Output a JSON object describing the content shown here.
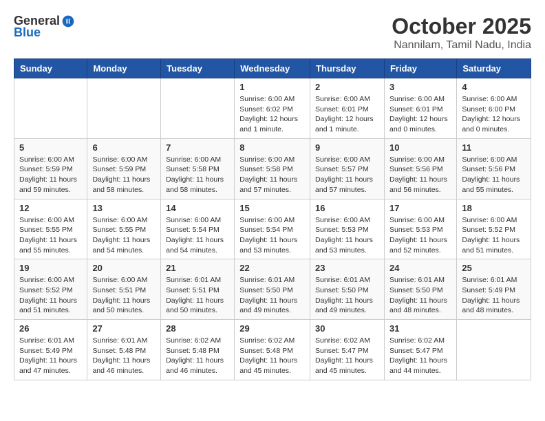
{
  "header": {
    "logo_general": "General",
    "logo_blue": "Blue",
    "month": "October 2025",
    "location": "Nannilam, Tamil Nadu, India"
  },
  "weekdays": [
    "Sunday",
    "Monday",
    "Tuesday",
    "Wednesday",
    "Thursday",
    "Friday",
    "Saturday"
  ],
  "weeks": [
    [
      {
        "day": "",
        "sunrise": "",
        "sunset": "",
        "daylight": ""
      },
      {
        "day": "",
        "sunrise": "",
        "sunset": "",
        "daylight": ""
      },
      {
        "day": "",
        "sunrise": "",
        "sunset": "",
        "daylight": ""
      },
      {
        "day": "1",
        "sunrise": "Sunrise: 6:00 AM",
        "sunset": "Sunset: 6:02 PM",
        "daylight": "Daylight: 12 hours and 1 minute."
      },
      {
        "day": "2",
        "sunrise": "Sunrise: 6:00 AM",
        "sunset": "Sunset: 6:01 PM",
        "daylight": "Daylight: 12 hours and 1 minute."
      },
      {
        "day": "3",
        "sunrise": "Sunrise: 6:00 AM",
        "sunset": "Sunset: 6:01 PM",
        "daylight": "Daylight: 12 hours and 0 minutes."
      },
      {
        "day": "4",
        "sunrise": "Sunrise: 6:00 AM",
        "sunset": "Sunset: 6:00 PM",
        "daylight": "Daylight: 12 hours and 0 minutes."
      }
    ],
    [
      {
        "day": "5",
        "sunrise": "Sunrise: 6:00 AM",
        "sunset": "Sunset: 5:59 PM",
        "daylight": "Daylight: 11 hours and 59 minutes."
      },
      {
        "day": "6",
        "sunrise": "Sunrise: 6:00 AM",
        "sunset": "Sunset: 5:59 PM",
        "daylight": "Daylight: 11 hours and 58 minutes."
      },
      {
        "day": "7",
        "sunrise": "Sunrise: 6:00 AM",
        "sunset": "Sunset: 5:58 PM",
        "daylight": "Daylight: 11 hours and 58 minutes."
      },
      {
        "day": "8",
        "sunrise": "Sunrise: 6:00 AM",
        "sunset": "Sunset: 5:58 PM",
        "daylight": "Daylight: 11 hours and 57 minutes."
      },
      {
        "day": "9",
        "sunrise": "Sunrise: 6:00 AM",
        "sunset": "Sunset: 5:57 PM",
        "daylight": "Daylight: 11 hours and 57 minutes."
      },
      {
        "day": "10",
        "sunrise": "Sunrise: 6:00 AM",
        "sunset": "Sunset: 5:56 PM",
        "daylight": "Daylight: 11 hours and 56 minutes."
      },
      {
        "day": "11",
        "sunrise": "Sunrise: 6:00 AM",
        "sunset": "Sunset: 5:56 PM",
        "daylight": "Daylight: 11 hours and 55 minutes."
      }
    ],
    [
      {
        "day": "12",
        "sunrise": "Sunrise: 6:00 AM",
        "sunset": "Sunset: 5:55 PM",
        "daylight": "Daylight: 11 hours and 55 minutes."
      },
      {
        "day": "13",
        "sunrise": "Sunrise: 6:00 AM",
        "sunset": "Sunset: 5:55 PM",
        "daylight": "Daylight: 11 hours and 54 minutes."
      },
      {
        "day": "14",
        "sunrise": "Sunrise: 6:00 AM",
        "sunset": "Sunset: 5:54 PM",
        "daylight": "Daylight: 11 hours and 54 minutes."
      },
      {
        "day": "15",
        "sunrise": "Sunrise: 6:00 AM",
        "sunset": "Sunset: 5:54 PM",
        "daylight": "Daylight: 11 hours and 53 minutes."
      },
      {
        "day": "16",
        "sunrise": "Sunrise: 6:00 AM",
        "sunset": "Sunset: 5:53 PM",
        "daylight": "Daylight: 11 hours and 53 minutes."
      },
      {
        "day": "17",
        "sunrise": "Sunrise: 6:00 AM",
        "sunset": "Sunset: 5:53 PM",
        "daylight": "Daylight: 11 hours and 52 minutes."
      },
      {
        "day": "18",
        "sunrise": "Sunrise: 6:00 AM",
        "sunset": "Sunset: 5:52 PM",
        "daylight": "Daylight: 11 hours and 51 minutes."
      }
    ],
    [
      {
        "day": "19",
        "sunrise": "Sunrise: 6:00 AM",
        "sunset": "Sunset: 5:52 PM",
        "daylight": "Daylight: 11 hours and 51 minutes."
      },
      {
        "day": "20",
        "sunrise": "Sunrise: 6:00 AM",
        "sunset": "Sunset: 5:51 PM",
        "daylight": "Daylight: 11 hours and 50 minutes."
      },
      {
        "day": "21",
        "sunrise": "Sunrise: 6:01 AM",
        "sunset": "Sunset: 5:51 PM",
        "daylight": "Daylight: 11 hours and 50 minutes."
      },
      {
        "day": "22",
        "sunrise": "Sunrise: 6:01 AM",
        "sunset": "Sunset: 5:50 PM",
        "daylight": "Daylight: 11 hours and 49 minutes."
      },
      {
        "day": "23",
        "sunrise": "Sunrise: 6:01 AM",
        "sunset": "Sunset: 5:50 PM",
        "daylight": "Daylight: 11 hours and 49 minutes."
      },
      {
        "day": "24",
        "sunrise": "Sunrise: 6:01 AM",
        "sunset": "Sunset: 5:50 PM",
        "daylight": "Daylight: 11 hours and 48 minutes."
      },
      {
        "day": "25",
        "sunrise": "Sunrise: 6:01 AM",
        "sunset": "Sunset: 5:49 PM",
        "daylight": "Daylight: 11 hours and 48 minutes."
      }
    ],
    [
      {
        "day": "26",
        "sunrise": "Sunrise: 6:01 AM",
        "sunset": "Sunset: 5:49 PM",
        "daylight": "Daylight: 11 hours and 47 minutes."
      },
      {
        "day": "27",
        "sunrise": "Sunrise: 6:01 AM",
        "sunset": "Sunset: 5:48 PM",
        "daylight": "Daylight: 11 hours and 46 minutes."
      },
      {
        "day": "28",
        "sunrise": "Sunrise: 6:02 AM",
        "sunset": "Sunset: 5:48 PM",
        "daylight": "Daylight: 11 hours and 46 minutes."
      },
      {
        "day": "29",
        "sunrise": "Sunrise: 6:02 AM",
        "sunset": "Sunset: 5:48 PM",
        "daylight": "Daylight: 11 hours and 45 minutes."
      },
      {
        "day": "30",
        "sunrise": "Sunrise: 6:02 AM",
        "sunset": "Sunset: 5:47 PM",
        "daylight": "Daylight: 11 hours and 45 minutes."
      },
      {
        "day": "31",
        "sunrise": "Sunrise: 6:02 AM",
        "sunset": "Sunset: 5:47 PM",
        "daylight": "Daylight: 11 hours and 44 minutes."
      },
      {
        "day": "",
        "sunrise": "",
        "sunset": "",
        "daylight": ""
      }
    ]
  ]
}
